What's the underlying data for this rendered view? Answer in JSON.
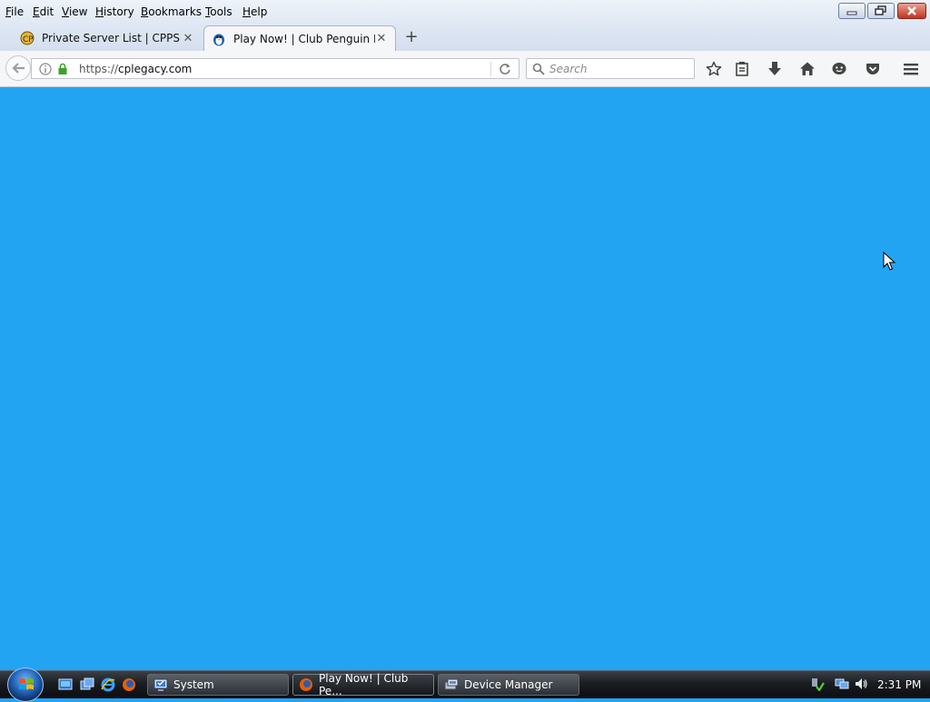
{
  "menubar": {
    "items": [
      {
        "label": "File",
        "accel": "F",
        "rest": "ile"
      },
      {
        "label": "Edit",
        "accel": "E",
        "rest": "dit"
      },
      {
        "label": "View",
        "accel": "V",
        "rest": "iew"
      },
      {
        "label": "History",
        "accel": "H",
        "rest": "istory"
      },
      {
        "label": "Bookmarks",
        "accel": "B",
        "rest": "ookmarks"
      },
      {
        "label": "Tools",
        "accel": "T",
        "rest": "ools"
      },
      {
        "label": "Help",
        "accel": "H",
        "rest": "elp"
      }
    ]
  },
  "tabs": [
    {
      "title": "Private Server List | CPPS W...",
      "icon": "cpps-favicon",
      "active": false
    },
    {
      "title": "Play Now! | Club Penguin L...",
      "icon": "club-penguin-favicon",
      "active": true
    }
  ],
  "navbar": {
    "url_scheme": "https://",
    "url_host": "cplegacy.com",
    "search_placeholder": "Search"
  },
  "content": {
    "background": "#23a4f2"
  },
  "taskbar": {
    "buttons": [
      {
        "label": "System",
        "icon": "system-icon"
      },
      {
        "label": "Play Now! | Club Pe...",
        "icon": "firefox-icon"
      },
      {
        "label": "Device Manager",
        "icon": "device-manager-icon"
      }
    ],
    "clock": "2:31 PM"
  }
}
